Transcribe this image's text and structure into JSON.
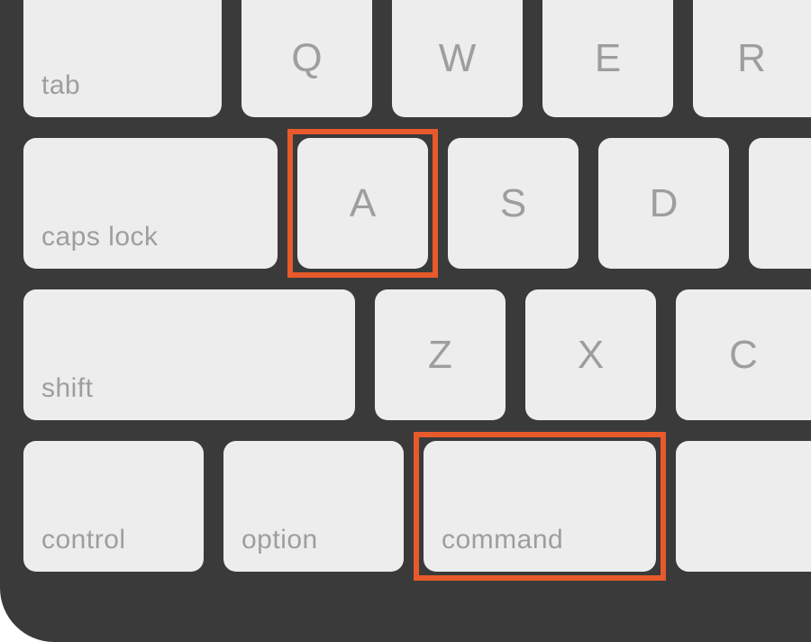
{
  "colors": {
    "keyboard_bg": "#3a3a3a",
    "key_bg": "#ededed",
    "key_text": "#9e9e9e",
    "highlight": "#e85a2b"
  },
  "keys": {
    "tab": {
      "label": "tab"
    },
    "q": {
      "label": "Q"
    },
    "w": {
      "label": "W"
    },
    "e": {
      "label": "E"
    },
    "r": {
      "label": "R"
    },
    "caps_lock": {
      "label": "caps lock"
    },
    "a": {
      "label": "A"
    },
    "s": {
      "label": "S"
    },
    "d": {
      "label": "D"
    },
    "shift": {
      "label": "shift"
    },
    "z": {
      "label": "Z"
    },
    "x": {
      "label": "X"
    },
    "c": {
      "label": "C"
    },
    "control": {
      "label": "control"
    },
    "option": {
      "label": "option"
    },
    "command": {
      "label": "command"
    }
  },
  "highlighted_keys": [
    "a",
    "command"
  ]
}
